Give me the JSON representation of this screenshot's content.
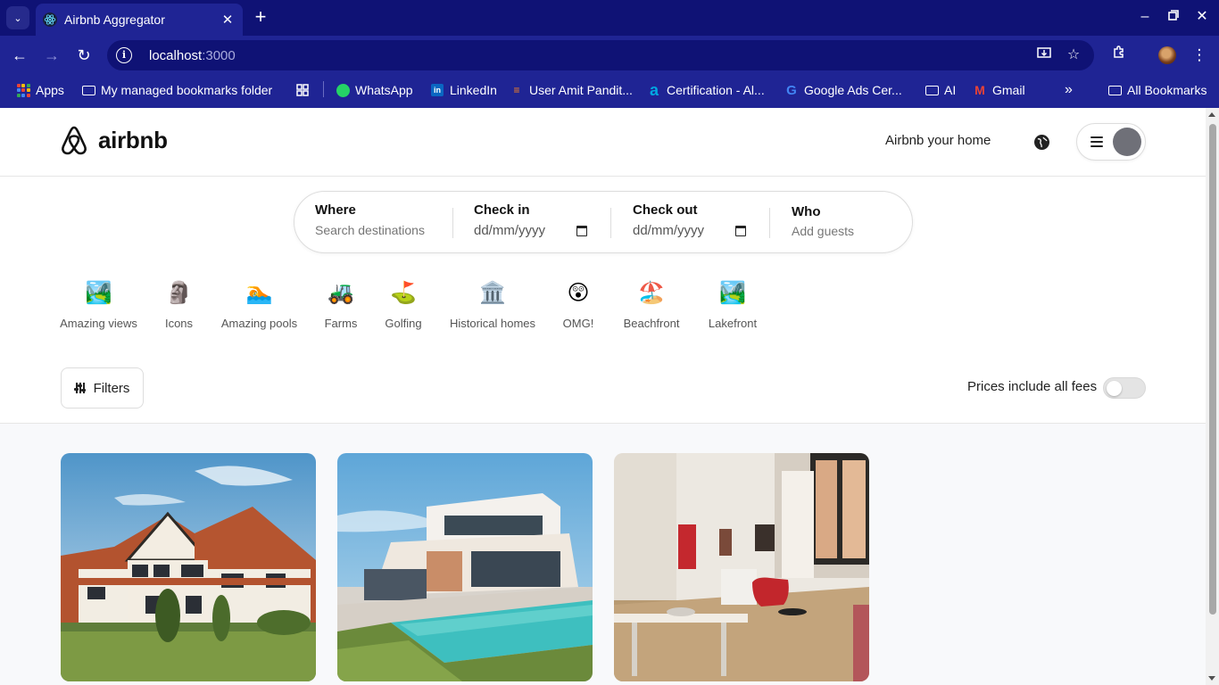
{
  "browser": {
    "tab_title": "Airbnb Aggregator",
    "url_host": "localhost",
    "url_port": ":3000",
    "bookmarks": [
      {
        "label": "Apps",
        "icon": "apps-grid-icon"
      },
      {
        "label": "My managed bookmarks folder",
        "icon": "managed-folder-icon"
      },
      {
        "label": "",
        "icon": "tab-groups-icon"
      },
      {
        "label": "WhatsApp",
        "icon": "whatsapp-icon"
      },
      {
        "label": "LinkedIn",
        "icon": "linkedin-icon"
      },
      {
        "label": "User Amit Pandit...",
        "icon": "stackoverflow-icon"
      },
      {
        "label": "Certification - Al...",
        "icon": "amazon-icon"
      },
      {
        "label": "Google Ads Cer...",
        "icon": "google-icon"
      },
      {
        "label": "AI",
        "icon": "folder-icon"
      },
      {
        "label": "Gmail",
        "icon": "gmail-icon"
      }
    ],
    "all_bookmarks": "All Bookmarks",
    "overflow": "»"
  },
  "header": {
    "logo_text": "airbnb",
    "host_link": "Airbnb your home"
  },
  "search": {
    "where_label": "Where",
    "where_placeholder": "Search destinations",
    "checkin_label": "Check in",
    "checkin_value": "dd/mm/yyyy",
    "checkout_label": "Check out",
    "checkout_value": "dd/mm/yyyy",
    "who_label": "Who",
    "who_value": "Add guests"
  },
  "categories": [
    {
      "label": "Amazing views",
      "icon": "🏞️"
    },
    {
      "label": "Icons",
      "icon": "🗿"
    },
    {
      "label": "Amazing pools",
      "icon": "🏊"
    },
    {
      "label": "Farms",
      "icon": "🚜"
    },
    {
      "label": "Golfing",
      "icon": "⛳"
    },
    {
      "label": "Historical homes",
      "icon": "🏛️"
    },
    {
      "label": "OMG!",
      "icon": "😲"
    },
    {
      "label": "Beachfront",
      "icon": "🏖️"
    },
    {
      "label": "Lakefront",
      "icon": "🏞️"
    }
  ],
  "filters": {
    "button_label": "Filters",
    "prices_label": "Prices include all fees",
    "prices_toggle_on": false
  },
  "colors": {
    "chrome_dark": "#0f1275",
    "chrome_light": "#1f2494",
    "listing_bg": "#f8f9fb"
  }
}
